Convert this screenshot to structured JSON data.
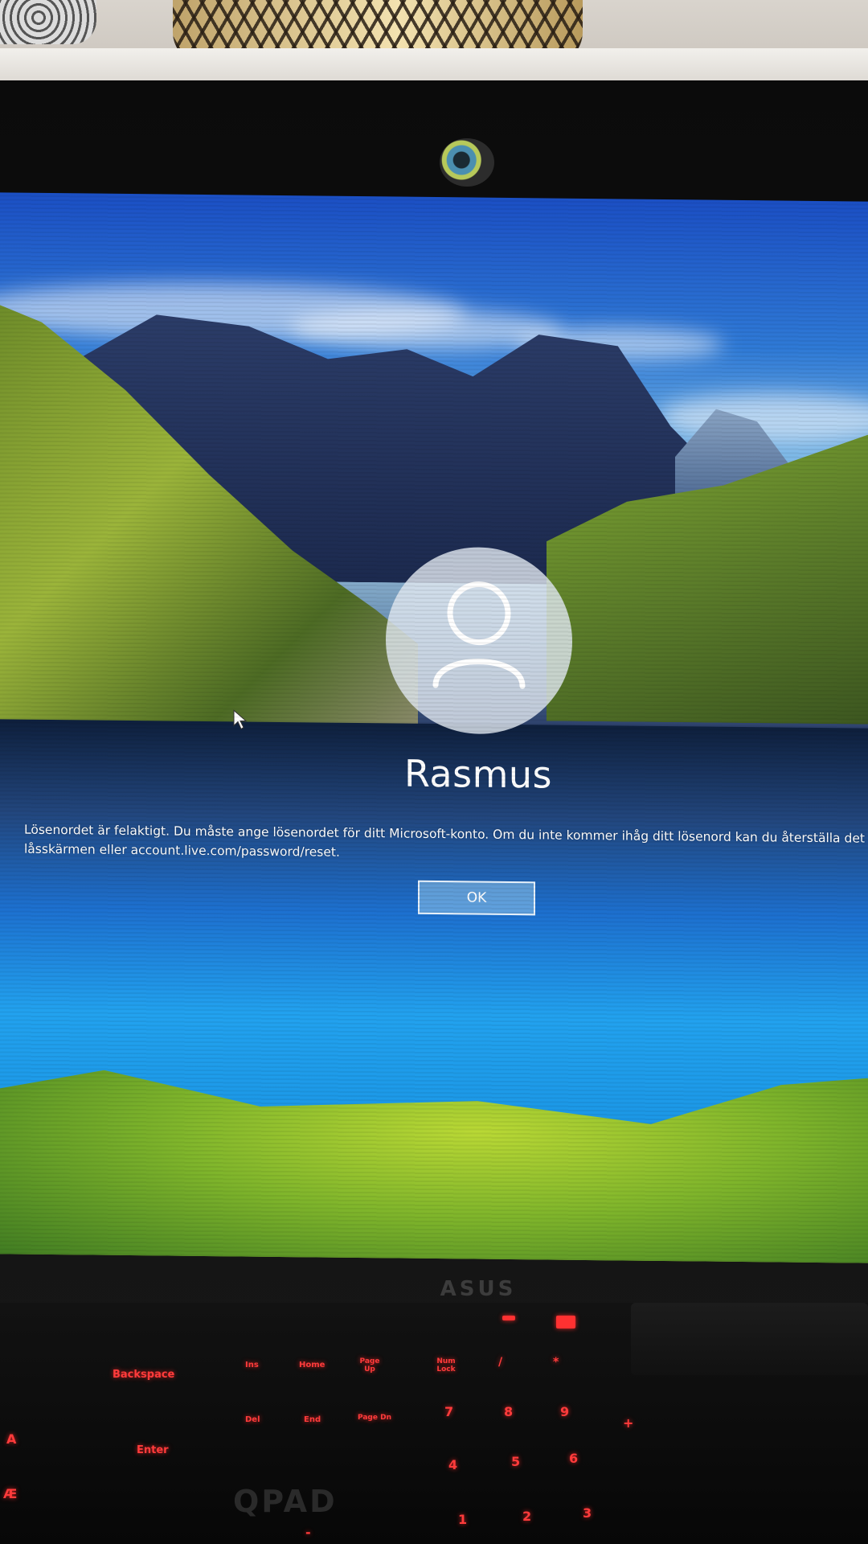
{
  "login": {
    "username": "Rasmus",
    "error_message_line1": "Lösenordet är felaktigt. Du måste ange lösenordet för ditt Microsoft-konto. Om du inte kommer ihåg ditt lösenord kan du återställa det",
    "error_message_line2": "låsskärmen eller account.live.com/password/reset.",
    "ok_label": "OK"
  },
  "device": {
    "brand": "ASUS",
    "keyboard_brand": "QPAD"
  },
  "keyboard_keys": {
    "backspace": "Backspace",
    "enter": "Enter",
    "ins": "Ins",
    "home": "Home",
    "page_up": "Page Up",
    "num_lock": "Num Lock",
    "del": "Del",
    "end": "End",
    "page_down": "Page Dn",
    "num7": "7",
    "num8": "8",
    "num9": "9",
    "num4": "4",
    "num5": "5",
    "num6": "6",
    "num1": "1",
    "num2": "2",
    "num3": "3",
    "slash": "/",
    "star": "*",
    "minus": "-",
    "plus": "+",
    "ae": "Æ",
    "a": "A"
  }
}
